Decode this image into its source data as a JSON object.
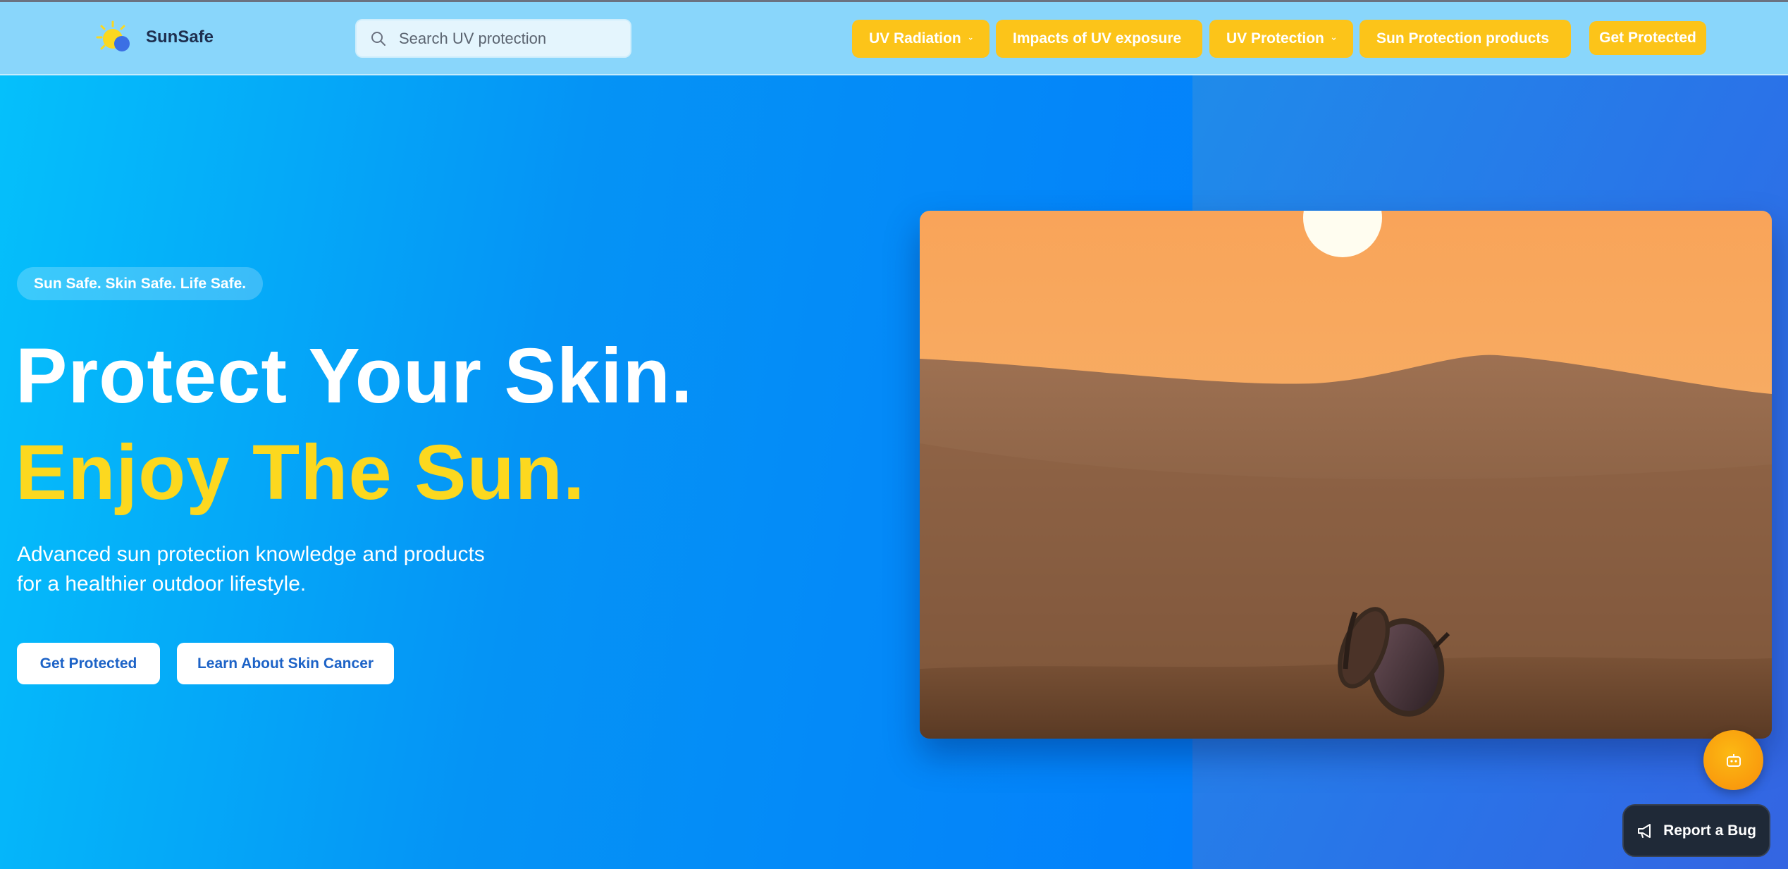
{
  "brand": {
    "name": "SunSafe",
    "logo_icon": "sun-cloud-logo"
  },
  "search": {
    "placeholder": "Search UV protection",
    "icon": "search-icon"
  },
  "nav": {
    "items": [
      {
        "label": "UV Radiation",
        "icon": "chevron-down-icon"
      },
      {
        "label": "Impacts of UV exposure",
        "icon": "chevron-down-icon"
      },
      {
        "label": "UV Protection",
        "icon": "chevron-down-icon"
      },
      {
        "label": "Sun Protection products",
        "icon": "chevron-down-icon"
      }
    ],
    "cta": "Get Protected"
  },
  "hero": {
    "tagline": "Sun Safe. Skin Safe. Life Safe.",
    "headline_line1": "Protect Your Skin.",
    "headline_line2": "Enjoy The Sun.",
    "subtext_line1": "Advanced sun protection knowledge and products",
    "subtext_line2": "for a healthier outdoor lifestyle.",
    "primary_button": "Get Protected",
    "secondary_button": "Learn About Skin Cancer"
  },
  "floating": {
    "assistant_icon": "robot-icon",
    "report_bug_label": "Report a Bug",
    "report_bug_icon": "megaphone-icon"
  },
  "colors": {
    "accent_yellow": "#fcc419",
    "headline_yellow": "#fcd81f",
    "hero_blue": "#0593f5",
    "header_bg": "#89d6fb",
    "button_text": "#1d63c7"
  }
}
